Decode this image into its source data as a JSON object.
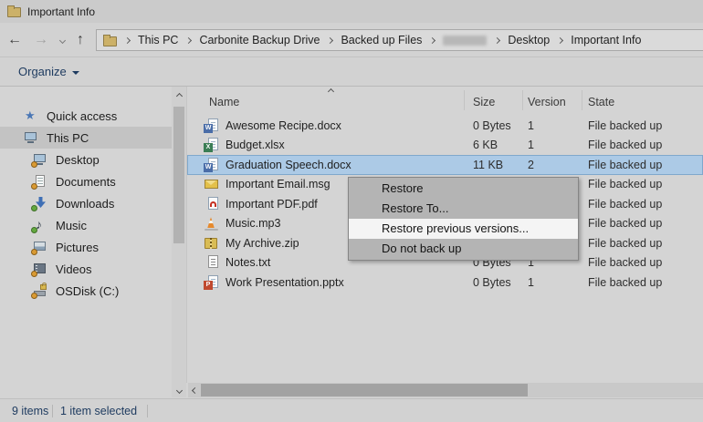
{
  "window": {
    "title": "Important Info"
  },
  "breadcrumb": {
    "segments": [
      "This PC",
      "Carbonite Backup Drive",
      "Backed up Files",
      "Desktop",
      "Important Info"
    ],
    "note_redacted_segment_between": [
      2,
      3
    ]
  },
  "toolbar": {
    "organize_label": "Organize"
  },
  "columns": {
    "name": "Name",
    "size": "Size",
    "version": "Version",
    "state": "State"
  },
  "files": [
    {
      "icon": "word-file-icon",
      "badge": "W",
      "name": "Awesome Recipe.docx",
      "size": "0 Bytes",
      "version": "1",
      "state": "File backed up",
      "selected": false
    },
    {
      "icon": "excel-file-icon",
      "badge": "X",
      "name": "Budget.xlsx",
      "size": "6 KB",
      "version": "1",
      "state": "File backed up",
      "selected": false
    },
    {
      "icon": "word-file-icon",
      "badge": "W",
      "name": "Graduation Speech.docx",
      "size": "11 KB",
      "version": "2",
      "state": "File backed up",
      "selected": true
    },
    {
      "icon": "email-file-icon",
      "badge": "",
      "name": "Important Email.msg",
      "size": "",
      "version": "",
      "state": "File backed up",
      "selected": false
    },
    {
      "icon": "pdf-file-icon",
      "badge": "",
      "name": "Important PDF.pdf",
      "size": "",
      "version": "",
      "state": "File backed up",
      "selected": false
    },
    {
      "icon": "vlc-file-icon",
      "badge": "",
      "name": "Music.mp3",
      "size": "",
      "version": "",
      "state": "File backed up",
      "selected": false
    },
    {
      "icon": "zip-file-icon",
      "badge": "",
      "name": "My Archive.zip",
      "size": "",
      "version": "",
      "state": "File backed up",
      "selected": false
    },
    {
      "icon": "txt-file-icon",
      "badge": "",
      "name": "Notes.txt",
      "size": "0 Bytes",
      "version": "1",
      "state": "File backed up",
      "selected": false
    },
    {
      "icon": "ppt-file-icon",
      "badge": "P",
      "name": "Work Presentation.pptx",
      "size": "0 Bytes",
      "version": "1",
      "state": "File backed up",
      "selected": false
    }
  ],
  "sidebar": {
    "items": [
      {
        "icon": "star-icon",
        "label": "Quick access",
        "selected": false,
        "badge": ""
      },
      {
        "icon": "monitor-icon",
        "label": "This PC",
        "selected": true,
        "badge": ""
      },
      {
        "icon": "monitor-icon",
        "label": "Desktop",
        "selected": false,
        "badge": "orange"
      },
      {
        "icon": "document-icon",
        "label": "Documents",
        "selected": false,
        "badge": "orange"
      },
      {
        "icon": "download-icon",
        "label": "Downloads",
        "selected": false,
        "badge": "green"
      },
      {
        "icon": "music-note-icon",
        "label": "Music",
        "selected": false,
        "badge": "green"
      },
      {
        "icon": "picture-icon",
        "label": "Pictures",
        "selected": false,
        "badge": "orange"
      },
      {
        "icon": "film-icon",
        "label": "Videos",
        "selected": false,
        "badge": "orange"
      },
      {
        "icon": "disk-lock-icon",
        "label": "OSDisk (C:)",
        "selected": false,
        "badge": "orange"
      }
    ]
  },
  "context_menu": {
    "items": [
      {
        "label": "Restore",
        "highlighted": false
      },
      {
        "label": "Restore To...",
        "highlighted": false
      },
      {
        "label": "Restore previous versions...",
        "highlighted": true
      },
      {
        "label": "Do not back up",
        "highlighted": false
      }
    ]
  },
  "status_bar": {
    "items_count": "9 items",
    "selected_count": "1 item selected"
  },
  "colors": {
    "selection_fill": "#accae6",
    "selection_border": "#7fa8cc",
    "sidebar_selected": "#c3c3c3",
    "menu_background": "#b4b4b4",
    "menu_highlight": "#f4f4f4",
    "status_text": "#1d3a5f",
    "folder_gold": "#ccb168"
  }
}
